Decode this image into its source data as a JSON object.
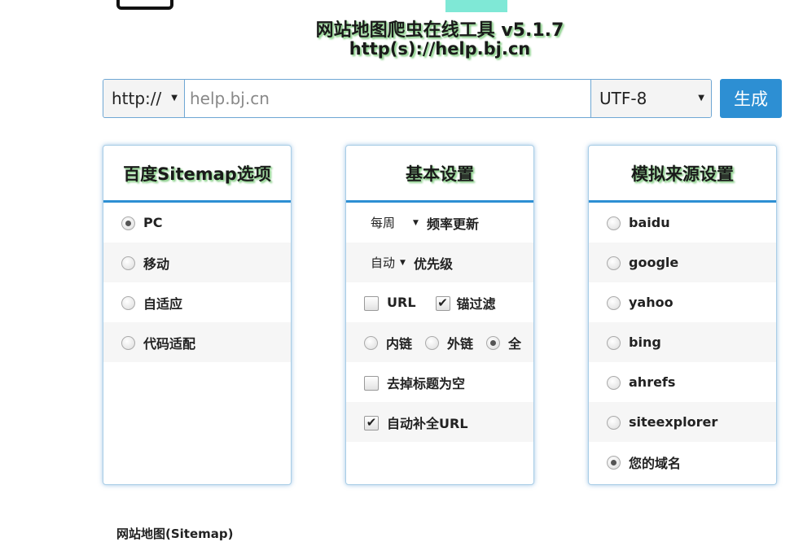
{
  "header": {
    "title": "网站地图爬虫在线工具 v5.1.7",
    "subtitle": "http(s)://help.bj.cn"
  },
  "url_bar": {
    "protocol": "http://",
    "url_placeholder": "help.bj.cn",
    "encoding": "UTF-8",
    "generate_label": "生成"
  },
  "panel_baidu": {
    "title": "百度Sitemap选项",
    "options": [
      {
        "label": "PC",
        "checked": true
      },
      {
        "label": "移动",
        "checked": false
      },
      {
        "label": "自适应",
        "checked": false
      },
      {
        "label": "代码适配",
        "checked": false
      }
    ]
  },
  "panel_basic": {
    "title": "基本设置",
    "frequency_value": "每周",
    "frequency_label": "频率更新",
    "priority_value": "自动",
    "priority_label": "优先级",
    "url_label": "URL",
    "url_checked": false,
    "anchor_filter_label": "锚过滤",
    "anchor_filter_checked": true,
    "internal_label": "内链",
    "external_label": "外链",
    "all_label": "全",
    "link_scope_selected": "全",
    "strip_title_label": "去掉标题为空",
    "strip_title_checked": false,
    "autocomplete_label": "自动补全URL",
    "autocomplete_checked": true
  },
  "panel_source": {
    "title": "模拟来源设置",
    "options": [
      {
        "label": "baidu",
        "checked": false
      },
      {
        "label": "google",
        "checked": false
      },
      {
        "label": "yahoo",
        "checked": false
      },
      {
        "label": "bing",
        "checked": false
      },
      {
        "label": "ahrefs",
        "checked": false
      },
      {
        "label": "siteexplorer",
        "checked": false
      },
      {
        "label": "您的域名",
        "checked": true
      }
    ]
  },
  "footer": {
    "section_label": "网站地图(Sitemap)"
  },
  "colors": {
    "accent": "#2d8fd3",
    "top_strip": "#7fe8d6",
    "title_glow": "#7cc87c"
  }
}
